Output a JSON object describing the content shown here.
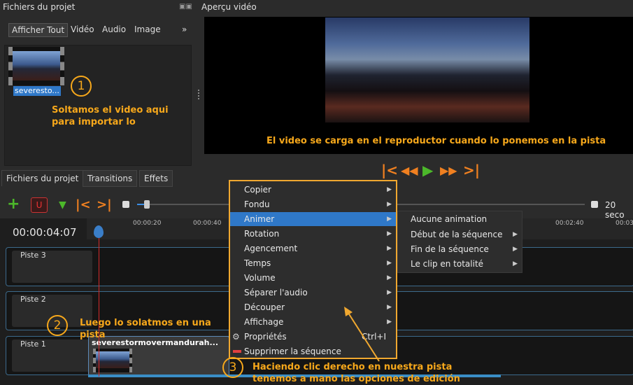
{
  "panels": {
    "project_files_title": "Fichiers du projet",
    "preview_title": "Aperçu vidéo"
  },
  "filters": [
    "Afficher Tout",
    "Vidéo",
    "Audio",
    "Image"
  ],
  "filters_more": "»",
  "file": {
    "name": "severesto..."
  },
  "tabs": [
    "Fichiers du projet",
    "Transitions",
    "Effets"
  ],
  "timecode": "00:00:04:07",
  "zoom_label": "20 seco",
  "ruler_ticks": [
    "00:00:20",
    "00:00:40",
    "00:02:40",
    "00:03"
  ],
  "tracks": [
    "Piste 3",
    "Piste 2",
    "Piste 1"
  ],
  "clip_name": "severestormovermandurah...",
  "context_menu": {
    "items": [
      {
        "label": "Copier",
        "submenu": true
      },
      {
        "label": "Fondu",
        "submenu": true
      },
      {
        "label": "Animer",
        "submenu": true,
        "highlighted": true
      },
      {
        "label": "Rotation",
        "submenu": true
      },
      {
        "label": "Agencement",
        "submenu": true
      },
      {
        "label": "Temps",
        "submenu": true
      },
      {
        "label": "Volume",
        "submenu": true
      },
      {
        "label": "Séparer l'audio",
        "submenu": true
      },
      {
        "label": "Découper",
        "submenu": true
      },
      {
        "label": "Affichage",
        "submenu": true
      },
      {
        "label": "Propriétés",
        "shortcut": "Ctrl+I",
        "icon": "gear-icon"
      },
      {
        "label": "Supprimer la séquence",
        "icon": "delete-icon"
      }
    ]
  },
  "submenu": {
    "items": [
      {
        "label": "Aucune animation",
        "submenu": false
      },
      {
        "label": "Début de la séquence",
        "submenu": true
      },
      {
        "label": "Fin de la séquence",
        "submenu": true
      },
      {
        "label": "Le clip en totalité",
        "submenu": true
      }
    ]
  },
  "annotations": {
    "step1_number": "1",
    "step1_text_line1": "Soltamos el video aqui",
    "step1_text_line2": "para importar lo",
    "preview_note": "El video se carga en el reproductor cuando lo ponemos en la pista",
    "step2_number": "2",
    "step2_text_line1": "Luego lo solatmos en una",
    "step2_text_line2": "pista",
    "step3_number": "3",
    "step3_text_line1": "Haciendo clic derecho en nuestra pista",
    "step3_text_line2": "tenemos a mano las opciones de edición"
  },
  "colors": {
    "accent": "#f7a81b",
    "menu_highlight": "#2f78c8",
    "playhead": "#d42a2a",
    "player_buttons": "#f08020",
    "play_button": "#4cb82a"
  },
  "icons": {
    "add": "plus-icon",
    "snap": "magnet-icon",
    "marker": "marker-icon",
    "prev_marker": "jump-start-icon",
    "next_marker": "jump-end-icon"
  }
}
